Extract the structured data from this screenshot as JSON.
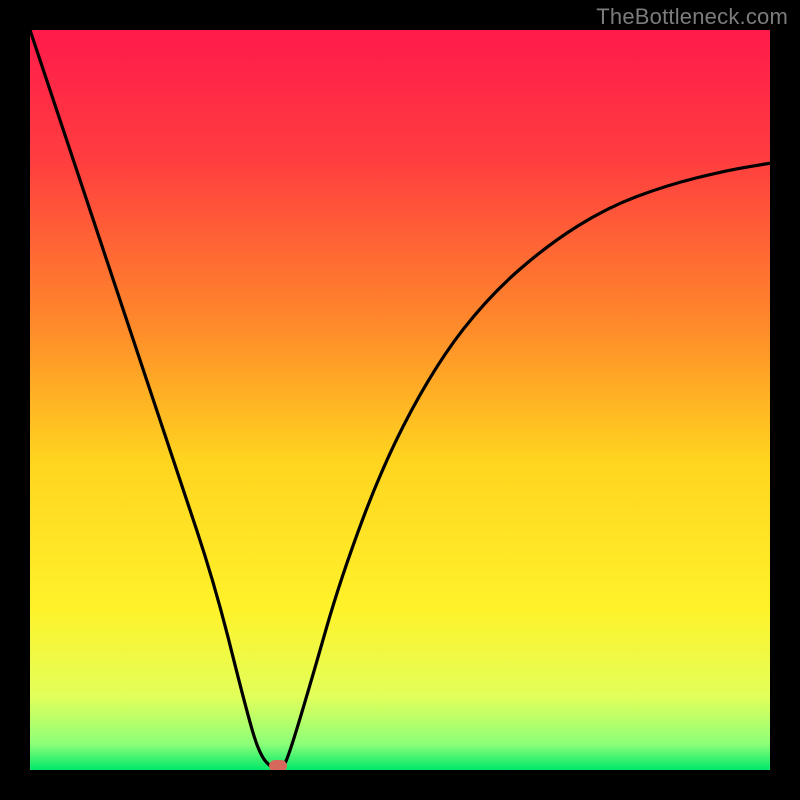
{
  "watermark": {
    "text": "TheBottleneck.com"
  },
  "chart_data": {
    "type": "line",
    "title": "",
    "xlabel": "",
    "ylabel": "",
    "xlim": [
      0,
      100
    ],
    "ylim": [
      0,
      100
    ],
    "grid": false,
    "legend": false,
    "background_gradient": {
      "stops": [
        {
          "pos": 0.0,
          "color": "#ff1a4b"
        },
        {
          "pos": 0.18,
          "color": "#ff3f3f"
        },
        {
          "pos": 0.4,
          "color": "#ff8a2a"
        },
        {
          "pos": 0.58,
          "color": "#ffd41f"
        },
        {
          "pos": 0.78,
          "color": "#fff22a"
        },
        {
          "pos": 0.9,
          "color": "#e3ff5a"
        },
        {
          "pos": 0.965,
          "color": "#8cff78"
        },
        {
          "pos": 1.0,
          "color": "#00e86a"
        }
      ]
    },
    "series": [
      {
        "name": "bottleneck-curve",
        "color": "#000000",
        "x": [
          0,
          5,
          10,
          15,
          20,
          25,
          29,
          31,
          33,
          34,
          35,
          38,
          42,
          48,
          55,
          62,
          70,
          78,
          86,
          94,
          100
        ],
        "y": [
          100,
          85,
          70,
          55,
          40,
          25,
          9,
          2,
          0,
          0,
          2,
          12,
          26,
          42,
          55,
          64,
          71,
          76,
          79,
          81,
          82
        ]
      }
    ],
    "marker": {
      "x": 33.5,
      "y": 0,
      "color": "#d6685c"
    }
  }
}
